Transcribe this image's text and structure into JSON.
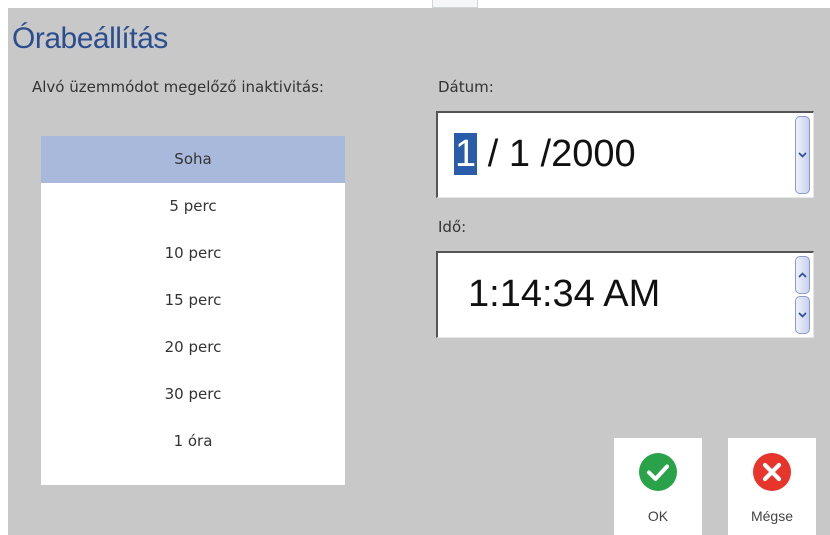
{
  "title": "Órabeállítás",
  "sleep": {
    "label": "Alvó üzemmódot megelőző inaktivitás:",
    "selected_index": 0,
    "options": [
      "Soha",
      "5 perc",
      "10 perc",
      "15 perc",
      "20 perc",
      "30 perc",
      "1 óra"
    ]
  },
  "date": {
    "label": "Dátum:",
    "month": "1",
    "rest": " / 1 /2000"
  },
  "time": {
    "label": "Idő:",
    "value": "1:14:34 AM"
  },
  "buttons": {
    "ok_label": "OK",
    "cancel_label": "Mégse"
  },
  "colors": {
    "title": "#2b4e8f",
    "selection": "#a9b9dc",
    "ok_icon": "#2aa24a",
    "cancel_icon": "#e8352b"
  },
  "icons": {
    "ok": "checkmark-circle-icon",
    "cancel": "x-circle-icon"
  }
}
